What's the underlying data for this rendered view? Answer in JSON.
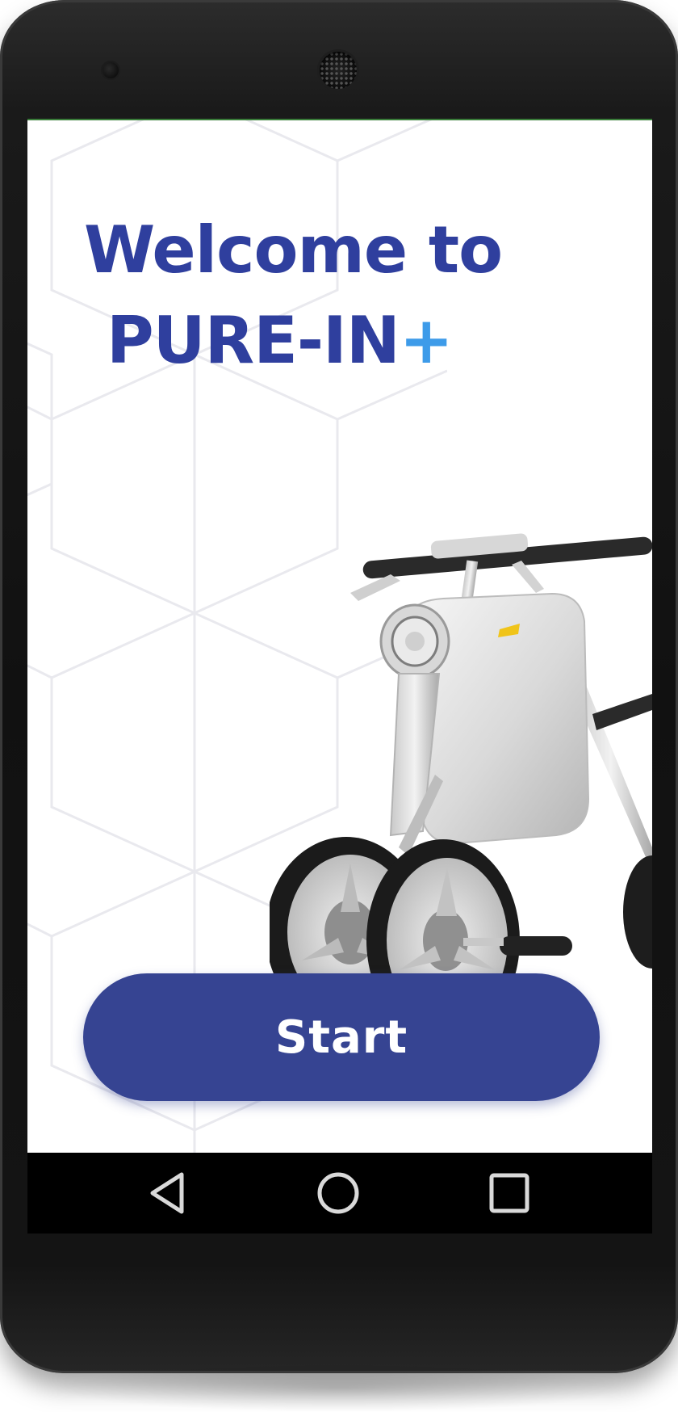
{
  "screen": {
    "title_line1": "Welcome to",
    "title_line2": "PURE-IN",
    "title_plus": "+",
    "start_label": "Start"
  },
  "icons": {
    "back": "back-triangle-icon",
    "home": "home-circle-icon",
    "recents": "recents-square-icon"
  },
  "colors": {
    "brand": "#2f3f9e",
    "accent": "#3d9be9",
    "button": "#364492",
    "button_text": "#ffffff"
  }
}
